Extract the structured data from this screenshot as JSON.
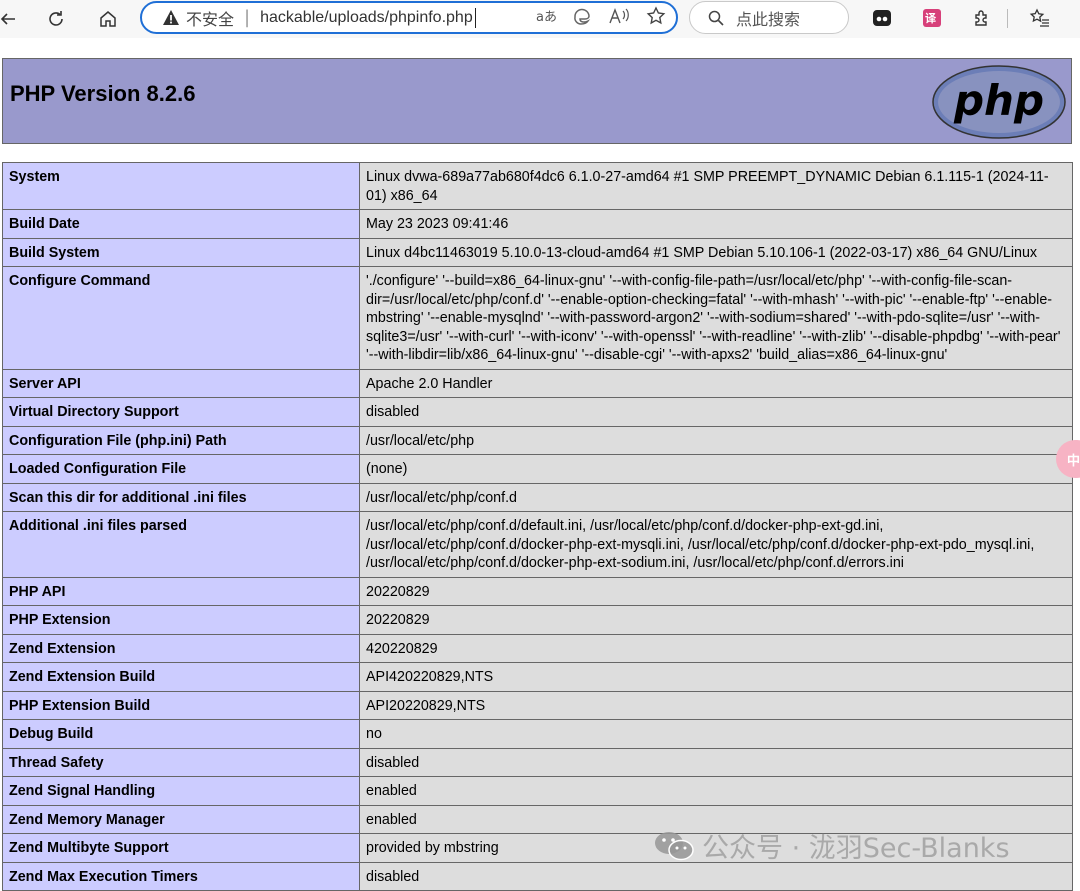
{
  "browser": {
    "address_insecure_label": "不安全",
    "address_separator": "|",
    "url": "hackable/uploads/phpinfo.php",
    "search_placeholder": "点此搜索",
    "accent": "#1f6fd6",
    "icons": [
      "back-arrow-icon",
      "refresh-icon",
      "home-icon",
      "warning-icon",
      "read-aloud-icon",
      "edge-icon",
      "text-size-icon",
      "favorite-star-icon",
      "search-icon",
      "extension-mask-icon",
      "translate-icon",
      "extensions-icon",
      "favorites-list-icon"
    ]
  },
  "page": {
    "title": "PHP Version 8.2.6",
    "logo_text": "php",
    "rows": [
      {
        "key": "System",
        "value": "Linux dvwa-689a77ab680f4dc6 6.1.0-27-amd64 #1 SMP PREEMPT_DYNAMIC Debian 6.1.115-1 (2024-11-01) x86_64"
      },
      {
        "key": "Build Date",
        "value": "May 23 2023 09:41:46"
      },
      {
        "key": "Build System",
        "value": "Linux d4bc11463019 5.10.0-13-cloud-amd64 #1 SMP Debian 5.10.106-1 (2022-03-17) x86_64 GNU/Linux"
      },
      {
        "key": "Configure Command",
        "value": "'./configure' '--build=x86_64-linux-gnu' '--with-config-file-path=/usr/local/etc/php' '--with-config-file-scan-dir=/usr/local/etc/php/conf.d' '--enable-option-checking=fatal' '--with-mhash' '--with-pic' '--enable-ftp' '--enable-mbstring' '--enable-mysqlnd' '--with-password-argon2' '--with-sodium=shared' '--with-pdo-sqlite=/usr' '--with-sqlite3=/usr' '--with-curl' '--with-iconv' '--with-openssl' '--with-readline' '--with-zlib' '--disable-phpdbg' '--with-pear' '--with-libdir=lib/x86_64-linux-gnu' '--disable-cgi' '--with-apxs2' 'build_alias=x86_64-linux-gnu'"
      },
      {
        "key": "Server API",
        "value": "Apache 2.0 Handler"
      },
      {
        "key": "Virtual Directory Support",
        "value": "disabled"
      },
      {
        "key": "Configuration File (php.ini) Path",
        "value": "/usr/local/etc/php"
      },
      {
        "key": "Loaded Configuration File",
        "value": "(none)"
      },
      {
        "key": "Scan this dir for additional .ini files",
        "value": "/usr/local/etc/php/conf.d"
      },
      {
        "key": "Additional .ini files parsed",
        "value": "/usr/local/etc/php/conf.d/default.ini, /usr/local/etc/php/conf.d/docker-php-ext-gd.ini, /usr/local/etc/php/conf.d/docker-php-ext-mysqli.ini, /usr/local/etc/php/conf.d/docker-php-ext-pdo_mysql.ini, /usr/local/etc/php/conf.d/docker-php-ext-sodium.ini, /usr/local/etc/php/conf.d/errors.ini"
      },
      {
        "key": "PHP API",
        "value": "20220829"
      },
      {
        "key": "PHP Extension",
        "value": "20220829"
      },
      {
        "key": "Zend Extension",
        "value": "420220829"
      },
      {
        "key": "Zend Extension Build",
        "value": "API420220829,NTS"
      },
      {
        "key": "PHP Extension Build",
        "value": "API20220829,NTS"
      },
      {
        "key": "Debug Build",
        "value": "no"
      },
      {
        "key": "Thread Safety",
        "value": "disabled"
      },
      {
        "key": "Zend Signal Handling",
        "value": "enabled"
      },
      {
        "key": "Zend Memory Manager",
        "value": "enabled"
      },
      {
        "key": "Zend Multibyte Support",
        "value": "provided by mbstring"
      },
      {
        "key": "Zend Max Execution Timers",
        "value": "disabled"
      }
    ],
    "header_color": "#9999cc",
    "key_cell_color": "#ccccff",
    "value_cell_color": "#dddddd"
  },
  "overlay": {
    "side_tab_label": "中",
    "watermark_text": "公众号 · 泷羽Sec-Blanks"
  }
}
